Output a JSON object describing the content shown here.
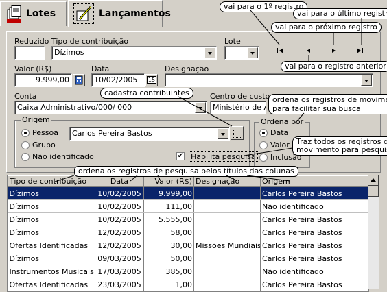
{
  "tabs": [
    {
      "label": "Lotes"
    },
    {
      "label": "Lançamentos"
    }
  ],
  "form": {
    "reduzido_label": "Reduzido",
    "reduzido_value": "",
    "tipo_label": "Tipo de contribuição",
    "tipo_value": "Dízimos",
    "lote_label": "Lote",
    "lote_value": "",
    "valor_label": "Valor (R$)",
    "valor_value": "9.999,00",
    "data_label": "Data",
    "data_value": "10/02/2005",
    "data_btn": "15",
    "designacao_label": "Designação",
    "designacao_value": "",
    "conta_label": "Conta",
    "conta_value": "Caixa Administrativo/000/ 000",
    "centro_label": "Centro de custo",
    "centro_value": "Ministério de Ad",
    "origem_title": "Origem",
    "origem_options": [
      "Pessoa",
      "Grupo",
      "Não identificado"
    ],
    "origem_selected": "Pessoa",
    "pessoa_value": "Carlos Pereira Bastos",
    "habilita_label": "Habilita pesquisa",
    "habilita_checked": true,
    "ordena_title": "Ordena por",
    "ordena_options": [
      "Data",
      "Valor",
      "Inclusão"
    ],
    "ordena_selected": "Data"
  },
  "callouts": {
    "primeiro": "vai para o 1º registro",
    "ultimo": "vai para o último registro",
    "proximo": "vai para o próximo registro",
    "anterior": "vai para o registro anterior",
    "cadastra": "cadastra contribuintes",
    "ordena_mov": "ordena os registros de movimento para facilitar sua busca",
    "ordena_mov_1": "ordena os registros de movimento",
    "ordena_mov_2": "para facilitar sua busca",
    "traz_1": "Traz todos os registros de",
    "traz_2": "movimento para pesquisa",
    "colunas": "ordena os registros de pesquisa pelos títulos das colunas"
  },
  "table": {
    "columns": [
      "Tipo de contribuição",
      "Data",
      "Valor (R$)",
      "Designação",
      "Origem"
    ],
    "rows": [
      [
        "Dízimos",
        "10/02/2005",
        "9.999,00",
        "",
        "Carlos Pereira Bastos"
      ],
      [
        "Dízimos",
        "10/02/2005",
        "111,00",
        "",
        "Não identificado"
      ],
      [
        "Dízimos",
        "10/02/2005",
        "5.555,00",
        "",
        "Carlos Pereira Bastos"
      ],
      [
        "Dízimos",
        "12/02/2005",
        "58,00",
        "",
        "Carlos Pereira Bastos"
      ],
      [
        "Ofertas Identificadas",
        "12/02/2005",
        "30,00",
        "Missões Mundiais",
        "Carlos Pereira Bastos"
      ],
      [
        "Dízimos",
        "09/03/2005",
        "50,00",
        "",
        "Carlos Pereira Bastos"
      ],
      [
        "Instrumentos Musicais",
        "17/03/2005",
        "385,00",
        "",
        "Não identificado"
      ],
      [
        "Ofertas Identificadas",
        "23/03/2005",
        "1,00",
        "",
        "Carlos Pereira Bastos"
      ]
    ],
    "selected_row": 0
  },
  "colors": {
    "selection": "#0a246a",
    "face": "#d4d0c8"
  }
}
